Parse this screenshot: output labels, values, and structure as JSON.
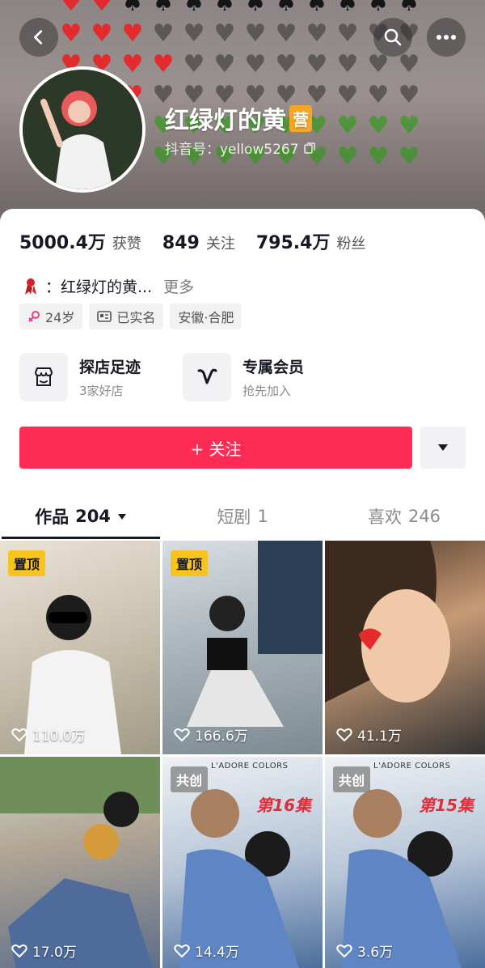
{
  "profile": {
    "name": "红绿灯的黄",
    "name_badge": "营",
    "douyin_id": "抖音号：yellow5267"
  },
  "stats": [
    {
      "value": "5000.4万",
      "label": "获赞"
    },
    {
      "value": "849",
      "label": "关注"
    },
    {
      "value": "795.4万",
      "label": "粉丝"
    }
  ],
  "bio": {
    "text": "：红绿灯的黄...",
    "more": "更多"
  },
  "tags": [
    {
      "icon": "female-icon",
      "text": "24岁"
    },
    {
      "icon": "id-card-icon",
      "text": "已实名"
    },
    {
      "icon": "",
      "text": "安徽·合肥"
    }
  ],
  "features": [
    {
      "icon": "store-icon",
      "title": "探店足迹",
      "subtitle": "3家好店"
    },
    {
      "icon": "vip-icon",
      "title": "专属会员",
      "subtitle": "抢先加入"
    }
  ],
  "follow_button": "+ 关注",
  "tabs": [
    {
      "label": "作品",
      "count": "204",
      "active": true
    },
    {
      "label": "短剧",
      "count": "1",
      "active": false
    },
    {
      "label": "喜欢",
      "count": "246",
      "active": false
    }
  ],
  "videos": [
    {
      "badge": "置顶",
      "likes": "110.0万"
    },
    {
      "badge": "置顶",
      "likes": "166.6万"
    },
    {
      "badge": "",
      "likes": "41.1万"
    },
    {
      "badge": "",
      "likes": "17.0万"
    },
    {
      "badge": "共创",
      "likes": "14.4万",
      "brand": "L'ADORE COLORS",
      "episode": "第16集"
    },
    {
      "badge": "共创",
      "likes": "3.6万",
      "brand": "L'ADORE COLORS",
      "episode": "第15集"
    }
  ],
  "colors": {
    "accent": "#fe2c55",
    "pin_badge": "#f9c31d",
    "name_badge": "#f5a623"
  }
}
